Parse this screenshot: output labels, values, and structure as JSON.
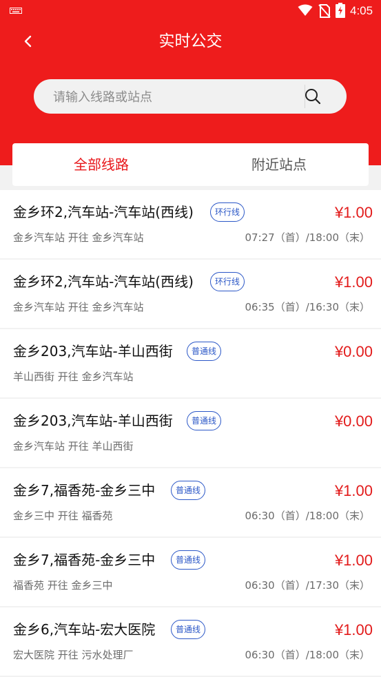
{
  "status_bar": {
    "time": "4:05"
  },
  "header": {
    "title": "实时公交"
  },
  "search": {
    "placeholder": "请输入线路或站点"
  },
  "tabs": [
    {
      "label": "全部线路",
      "active": true
    },
    {
      "label": "附近站点",
      "active": false
    }
  ],
  "routes": [
    {
      "name": "金乡环2,汽车站-汽车站(西线)",
      "type": "环行线",
      "price": "¥1.00",
      "direction": "金乡汽车站 开往 金乡汽车站",
      "schedule": "07:27（首）/18:00（末）"
    },
    {
      "name": "金乡环2,汽车站-汽车站(西线)",
      "type": "环行线",
      "price": "¥1.00",
      "direction": "金乡汽车站 开往 金乡汽车站",
      "schedule": "06:35（首）/16:30（末）"
    },
    {
      "name": "金乡203,汽车站-羊山西街",
      "type": "普通线",
      "price": "¥0.00",
      "direction": "羊山西街 开往 金乡汽车站",
      "schedule": ""
    },
    {
      "name": "金乡203,汽车站-羊山西街",
      "type": "普通线",
      "price": "¥0.00",
      "direction": "金乡汽车站 开往 羊山西街",
      "schedule": ""
    },
    {
      "name": "金乡7,福香苑-金乡三中",
      "type": "普通线",
      "price": "¥1.00",
      "direction": "金乡三中 开往 福香苑",
      "schedule": "06:30（首）/18:00（末）"
    },
    {
      "name": "金乡7,福香苑-金乡三中",
      "type": "普通线",
      "price": "¥1.00",
      "direction": "福香苑 开往 金乡三中",
      "schedule": "06:30（首）/17:30（末）"
    },
    {
      "name": "金乡6,汽车站-宏大医院",
      "type": "普通线",
      "price": "¥1.00",
      "direction": "宏大医院 开往 污水处理厂",
      "schedule": "06:30（首）/18:00（末）"
    }
  ],
  "colors": {
    "brand_red": "#ee1c1c",
    "price_red": "#e21b1b",
    "badge_blue": "#2b57c7"
  }
}
